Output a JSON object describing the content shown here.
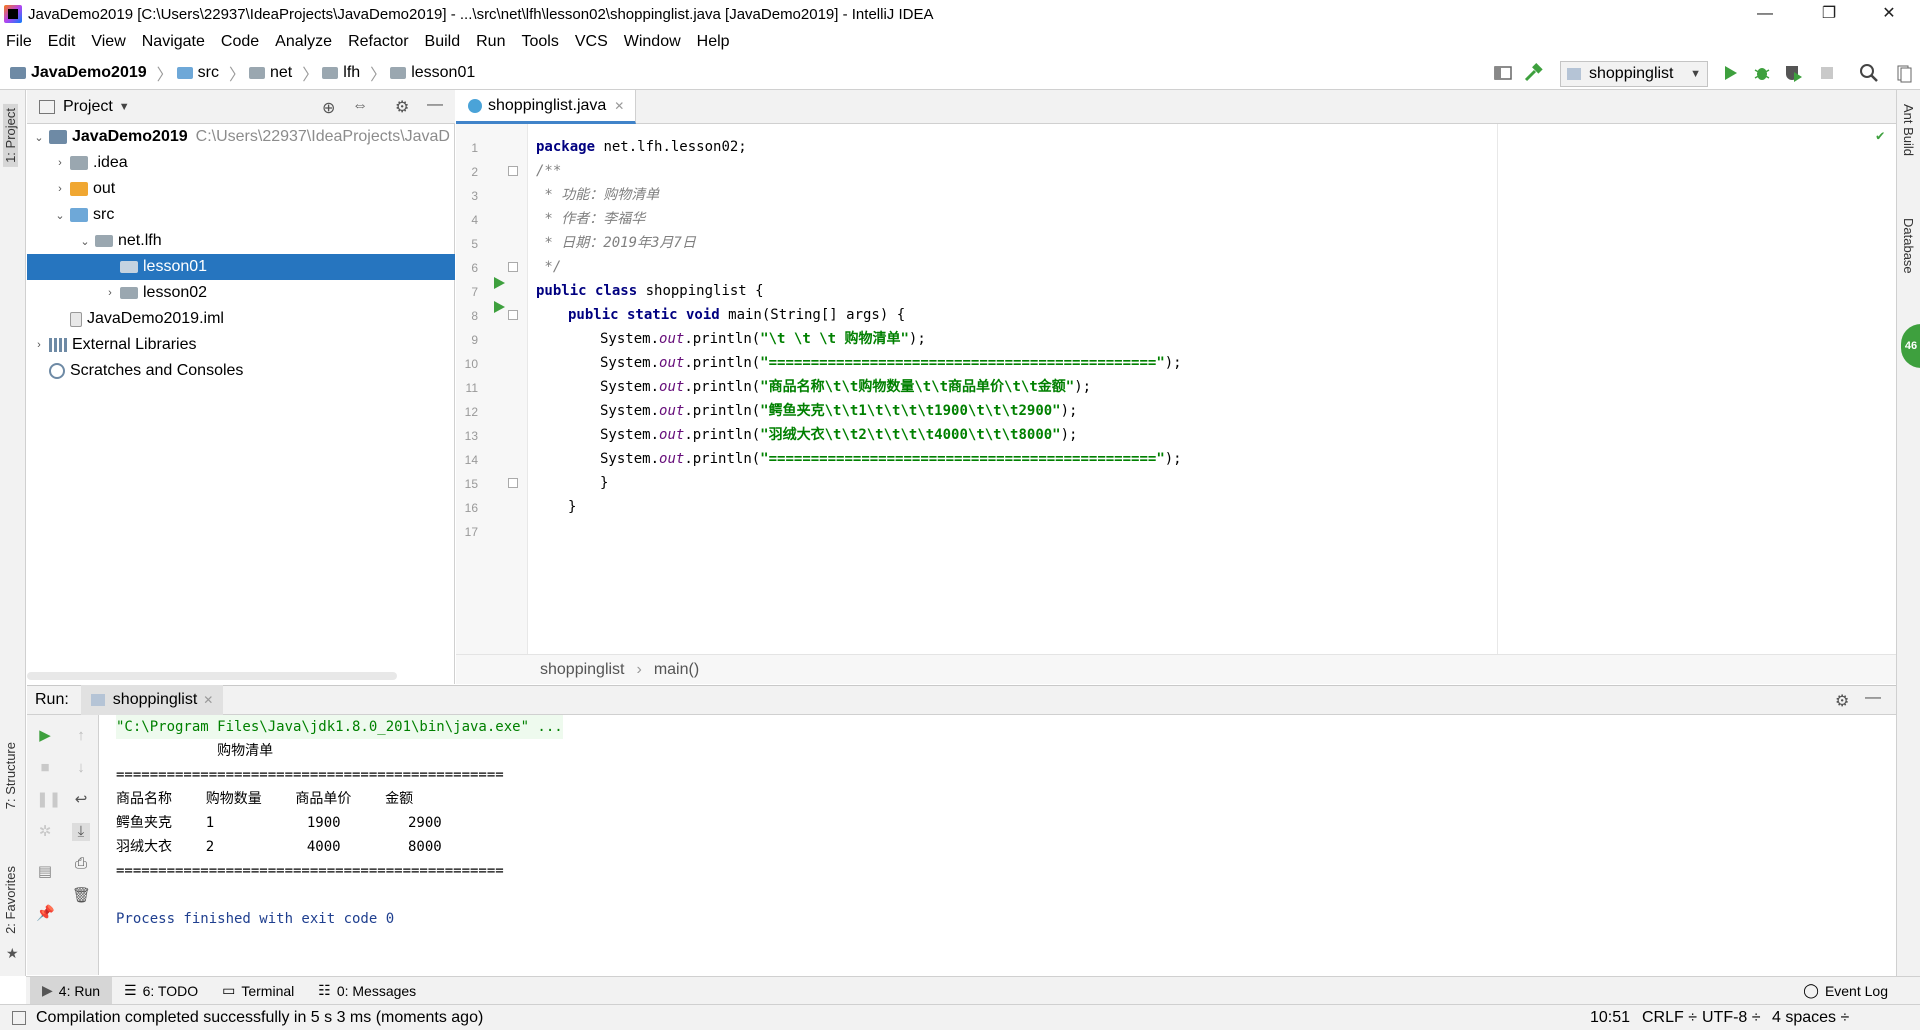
{
  "window": {
    "title": "JavaDemo2019 [C:\\Users\\22937\\IdeaProjects\\JavaDemo2019] - ...\\src\\net\\lfh\\lesson02\\shoppinglist.java [JavaDemo2019] - IntelliJ IDEA",
    "minimize": "—",
    "restore": "❐",
    "close": "✕"
  },
  "menu": [
    "File",
    "Edit",
    "View",
    "Navigate",
    "Code",
    "Analyze",
    "Refactor",
    "Build",
    "Run",
    "Tools",
    "VCS",
    "Window",
    "Help"
  ],
  "breadcrumb": {
    "project": "JavaDemo2019",
    "items": [
      "src",
      "net",
      "lfh",
      "lesson01"
    ]
  },
  "toolbar": {
    "run_config": "shoppinglist"
  },
  "left_strip": {
    "project": "1: Project",
    "structure": "7: Structure",
    "favorites": "2: Favorites"
  },
  "project_panel": {
    "title": "Project",
    "tree": [
      {
        "label": "JavaDemo2019",
        "path": "C:\\Users\\22937\\IdeaProjects\\JavaD"
      },
      {
        "label": ".idea"
      },
      {
        "label": "out"
      },
      {
        "label": "src"
      },
      {
        "label": "net.lfh"
      },
      {
        "label": "lesson01"
      },
      {
        "label": "lesson02"
      },
      {
        "label": "JavaDemo2019.iml"
      },
      {
        "label": "External Libraries"
      },
      {
        "label": "Scratches and Consoles"
      }
    ]
  },
  "editor": {
    "tab": "shoppinglist.java",
    "line_numbers": [
      "1",
      "2",
      "3",
      "4",
      "5",
      "6",
      "7",
      "8",
      "9",
      "10",
      "11",
      "12",
      "13",
      "14",
      "15",
      "16",
      "17"
    ],
    "code": {
      "l1_kw": "package",
      "l1_rest": " net.lfh.lesson02;",
      "l2": "/**",
      "l3": " * 功能：购物清单",
      "l4": " * 作者：李福华",
      "l5": " * 日期：2019年3月7日",
      "l6": " */",
      "l7_kw": "public class",
      "l7_rest": " shoppinglist {",
      "l8_kw": "public static void",
      "l8_rest": " main(String[] args) {",
      "sys": "System.",
      "out": "out",
      "println": ".println(",
      "end": ");",
      "s9": "\"\\t \\t \\t 购物清单\"",
      "s10": "\"==============================================\"",
      "s11": "\"商品名称\\t\\t购物数量\\t\\t商品单价\\t\\t金额\"",
      "s12": "\"鳄鱼夹克\\t\\t1\\t\\t\\t\\t1900\\t\\t\\t2900\"",
      "s13": "\"羽绒大衣\\t\\t2\\t\\t\\t\\t4000\\t\\t\\t8000\"",
      "s14": "\"==============================================\"",
      "l15": "}",
      "l16": "}"
    },
    "breadcrumbs": [
      "shoppinglist",
      "main()"
    ]
  },
  "run_panel": {
    "label": "Run:",
    "tab": "shoppinglist",
    "output": [
      "\"C:\\Program Files\\Java\\jdk1.8.0_201\\bin\\java.exe\" ...",
      "            购物清单",
      "==============================================",
      "商品名称    购物数量    商品单价    金额",
      "鳄鱼夹克    1           1900        2900",
      "羽绒大衣    2           4000        8000",
      "==============================================",
      "",
      "Process finished with exit code 0"
    ]
  },
  "bottom_tabs": {
    "run": "4: Run",
    "todo": "6: TODO",
    "terminal": "Terminal",
    "messages": "0: Messages",
    "event_log": "Event Log"
  },
  "status": {
    "message": "Compilation completed successfully in 5 s 3 ms (moments ago)",
    "position": "10:51",
    "line_sep": "CRLF ÷",
    "encoding": "UTF-8 ÷",
    "indent": "4 spaces ÷"
  },
  "right_strip": {
    "ant": "Ant Build",
    "database": "Database",
    "badge": "46"
  },
  "colors": {
    "selection": "#2675bf",
    "keyword": "#000080",
    "string": "#008000",
    "comment": "#808080",
    "run_green": "#3ea03e",
    "current_line": "#fffae3"
  }
}
